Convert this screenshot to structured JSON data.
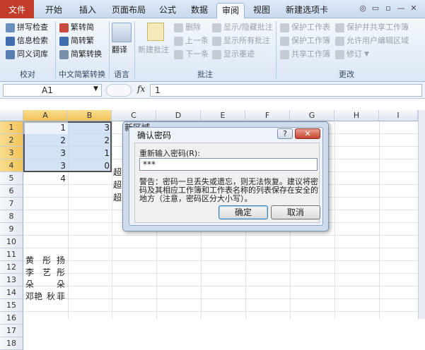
{
  "tabs": {
    "file": "文件",
    "items": [
      "开始",
      "插入",
      "页面布局",
      "公式",
      "数据",
      "审阅",
      "视图",
      "新建选项卡"
    ]
  },
  "ribbon": {
    "proofing": {
      "items": [
        "拼写检查",
        "信息检索",
        "同义词库"
      ],
      "group": "校对"
    },
    "chinese": {
      "items": [
        "繁转简",
        "简转繁",
        "简繁转换"
      ],
      "group": "中文简繁转换"
    },
    "language": {
      "item": "翻译",
      "group": "语言"
    },
    "comments": {
      "new": "新建批注",
      "items": [
        "删除",
        "上一条",
        "下一条"
      ],
      "items2": [
        "显示/隐藏批注",
        "显示所有批注",
        "显示墨迹"
      ],
      "group": "批注"
    },
    "changes": {
      "items": [
        "保护工作表",
        "保护工作簿",
        "共享工作簿"
      ],
      "items2": [
        "保护并共享工作簿",
        "允许用户编辑区域",
        "修订"
      ],
      "group": "更改"
    }
  },
  "formula": {
    "namebox": "A1",
    "fx": "fx",
    "value": "1"
  },
  "grid": {
    "columns": [
      "A",
      "B",
      "C",
      "D",
      "E",
      "F",
      "G",
      "H",
      "I"
    ],
    "rows": [
      "1",
      "2",
      "3",
      "4",
      "5",
      "6",
      "7",
      "8",
      "9",
      "10",
      "11",
      "12",
      "13",
      "14",
      "15",
      "16",
      "17",
      "18"
    ],
    "A": [
      "1",
      "2",
      "3",
      "3",
      "4"
    ],
    "B": [
      "3",
      "2",
      "1",
      "0"
    ],
    "C": [
      "超",
      "超",
      "超"
    ],
    "names": [
      [
        "黄",
        "彤",
        "扬"
      ],
      [
        "李",
        "艺",
        "彤"
      ],
      [
        "朵",
        "",
        "朵"
      ],
      [
        "邓艳",
        "秋",
        "菲"
      ]
    ]
  },
  "dialog": {
    "background_title": "新区域",
    "title": "确认密码",
    "help": "?",
    "close": "✕",
    "label": "重新输入密码(R):",
    "value": "***",
    "warning": "警告：密码一旦丢失或遗忘，则无法恢复。建议将密码及其相应工作簿和工作表名称的列表保存在安全的地方（注意，密码区分大小写）。",
    "ok": "确定",
    "cancel": "取消"
  }
}
